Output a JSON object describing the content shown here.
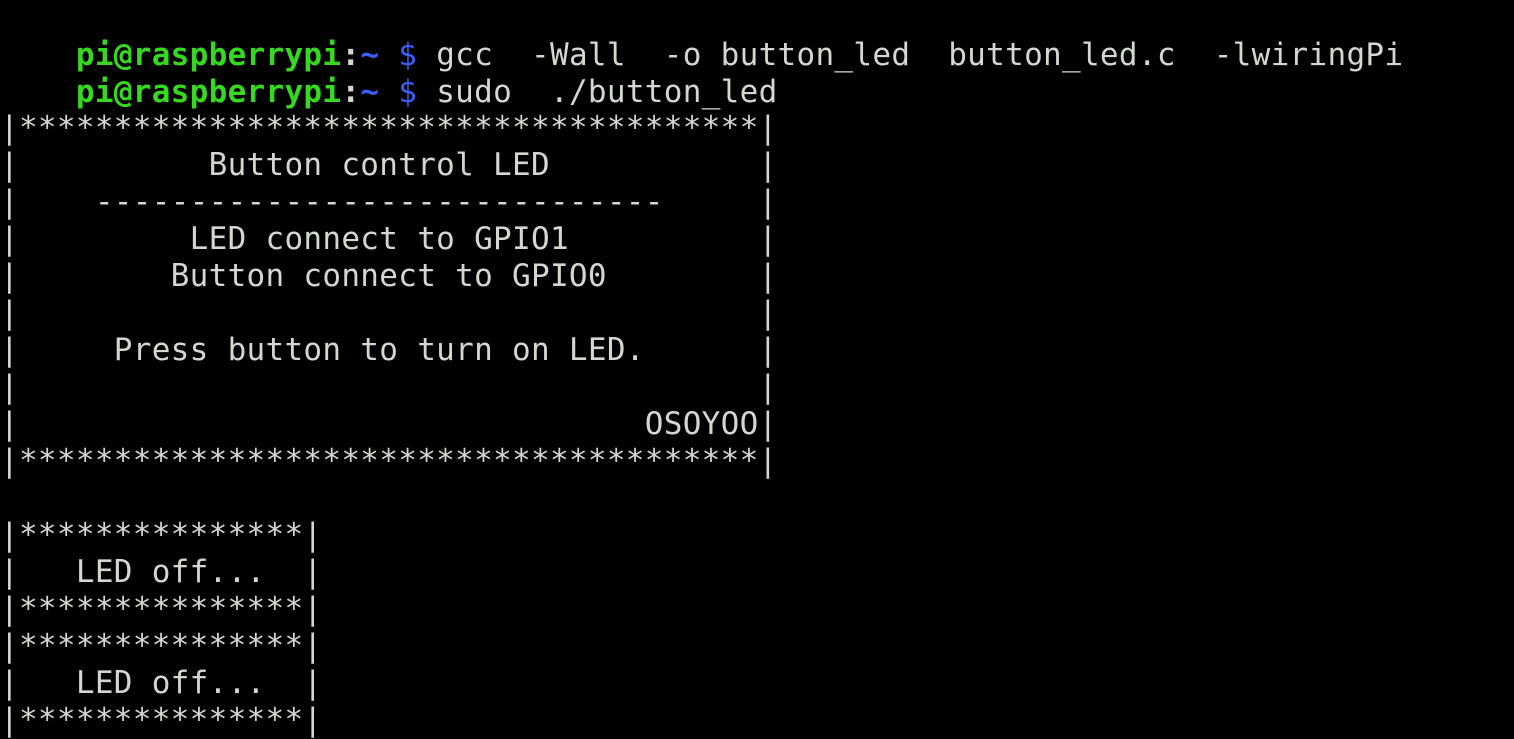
{
  "terminal": {
    "prompt": {
      "user_host": "pi@raspberrypi",
      "separator": ":",
      "path": "~",
      "symbol": "$"
    },
    "commands": [
      " gcc  -Wall  -o button_led  button_led.c  -lwiringPi",
      " sudo  ./button_led"
    ],
    "banner": [
      "|***************************************|",
      "|          Button control LED           |",
      "|    ------------------------------     |",
      "|         LED connect to GPIO1          |",
      "|        Button connect to GPIO0        |",
      "|                                       |",
      "|     Press button to turn on LED.      |",
      "|                                       |",
      "|                                 OSOYOO|",
      "|***************************************|"
    ],
    "status_blocks": [
      "|***************|",
      "|   LED off...  |",
      "|***************|",
      "|***************|",
      "|   LED off...  |",
      "|***************|"
    ],
    "colors": {
      "background": "#000000",
      "text": "#d3d7cf",
      "user_host": "#36d91f",
      "path": "#3b5ef5"
    }
  }
}
